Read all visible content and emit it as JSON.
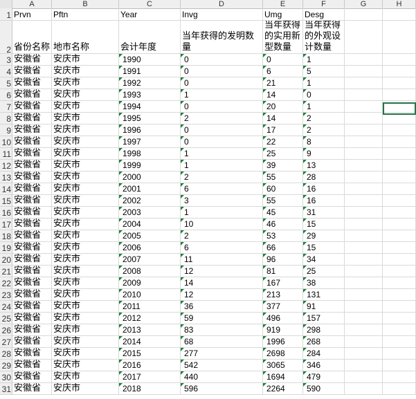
{
  "columns": [
    {
      "label": "A",
      "left": 0
    },
    {
      "label": "B",
      "left": 0
    },
    {
      "label": "C",
      "left": 0
    },
    {
      "label": "D",
      "left": 0
    },
    {
      "label": "E",
      "left": 0
    },
    {
      "label": "F",
      "left": 0
    },
    {
      "label": "G",
      "left": 0
    },
    {
      "label": "H",
      "left": 0
    }
  ],
  "headers_en": [
    "Prvn",
    "Pftn",
    "Year",
    "Invg",
    "Umg",
    "Desg"
  ],
  "headers_cn": [
    "省份名称",
    "地市名称",
    "会计年度",
    "当年获得的发明数量",
    "当年获得的实用新型数量",
    "当年获得的外观设计数量"
  ],
  "rows": [
    [
      "安徽省",
      "安庆市",
      "1990",
      "0",
      "0",
      "1"
    ],
    [
      "安徽省",
      "安庆市",
      "1991",
      "0",
      "6",
      "5"
    ],
    [
      "安徽省",
      "安庆市",
      "1992",
      "0",
      "21",
      "1"
    ],
    [
      "安徽省",
      "安庆市",
      "1993",
      "1",
      "14",
      "0"
    ],
    [
      "安徽省",
      "安庆市",
      "1994",
      "0",
      "20",
      "1"
    ],
    [
      "安徽省",
      "安庆市",
      "1995",
      "2",
      "14",
      "2"
    ],
    [
      "安徽省",
      "安庆市",
      "1996",
      "0",
      "17",
      "2"
    ],
    [
      "安徽省",
      "安庆市",
      "1997",
      "0",
      "22",
      "8"
    ],
    [
      "安徽省",
      "安庆市",
      "1998",
      "1",
      "25",
      "9"
    ],
    [
      "安徽省",
      "安庆市",
      "1999",
      "1",
      "39",
      "13"
    ],
    [
      "安徽省",
      "安庆市",
      "2000",
      "2",
      "55",
      "28"
    ],
    [
      "安徽省",
      "安庆市",
      "2001",
      "6",
      "60",
      "16"
    ],
    [
      "安徽省",
      "安庆市",
      "2002",
      "3",
      "55",
      "16"
    ],
    [
      "安徽省",
      "安庆市",
      "2003",
      "1",
      "45",
      "31"
    ],
    [
      "安徽省",
      "安庆市",
      "2004",
      "10",
      "46",
      "15"
    ],
    [
      "安徽省",
      "安庆市",
      "2005",
      "2",
      "53",
      "29"
    ],
    [
      "安徽省",
      "安庆市",
      "2006",
      "6",
      "66",
      "15"
    ],
    [
      "安徽省",
      "安庆市",
      "2007",
      "11",
      "96",
      "34"
    ],
    [
      "安徽省",
      "安庆市",
      "2008",
      "12",
      "81",
      "25"
    ],
    [
      "安徽省",
      "安庆市",
      "2009",
      "14",
      "167",
      "38"
    ],
    [
      "安徽省",
      "安庆市",
      "2010",
      "12",
      "213",
      "131"
    ],
    [
      "安徽省",
      "安庆市",
      "2011",
      "36",
      "377",
      "91"
    ],
    [
      "安徽省",
      "安庆市",
      "2012",
      "59",
      "496",
      "157"
    ],
    [
      "安徽省",
      "安庆市",
      "2013",
      "83",
      "919",
      "298"
    ],
    [
      "安徽省",
      "安庆市",
      "2014",
      "68",
      "1996",
      "268"
    ],
    [
      "安徽省",
      "安庆市",
      "2015",
      "277",
      "2698",
      "284"
    ],
    [
      "安徽省",
      "安庆市",
      "2016",
      "542",
      "3065",
      "346"
    ],
    [
      "安徽省",
      "安庆市",
      "2017",
      "440",
      "1694",
      "479"
    ],
    [
      "安徽省",
      "安庆市",
      "2018",
      "596",
      "2264",
      "590"
    ]
  ],
  "row_numbers": [
    "1",
    "2",
    "3",
    "4",
    "5",
    "6",
    "7",
    "8",
    "9",
    "10",
    "11",
    "12",
    "13",
    "14",
    "15",
    "16",
    "17",
    "18",
    "19",
    "20",
    "21",
    "22",
    "23",
    "24",
    "25",
    "26",
    "27",
    "28",
    "29",
    "30",
    "31"
  ],
  "colors": {
    "selection": "#217346",
    "error_triangle": "#1e7f3a"
  }
}
